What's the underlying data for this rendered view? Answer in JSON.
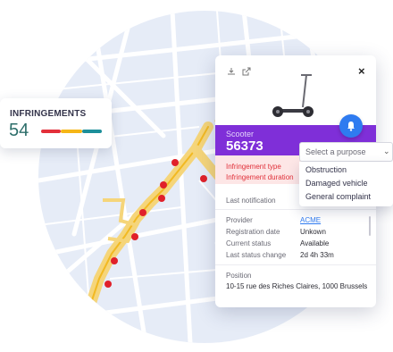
{
  "infringements": {
    "title": "INFRINGEMENTS",
    "count": "54",
    "bar_colors": [
      "#e3303a",
      "#f5b617",
      "#1d8f9a"
    ]
  },
  "popup": {
    "icons": [
      "download-icon",
      "external-link-icon"
    ],
    "close_label": "×",
    "vehicle_image": "scooter",
    "vehicle_type": "Scooter",
    "vehicle_id": "56373",
    "header_color": "#7f2fd8",
    "infringement_type_label": "Infringement type",
    "infringement_duration_label": "Infringement duration",
    "last_notification_label": "Last notification",
    "details": [
      {
        "label": "Provider",
        "value": "ACME",
        "link": true
      },
      {
        "label": "Registration date",
        "value": "Unkown",
        "link": false
      },
      {
        "label": "Current status",
        "value": "Available",
        "link": false
      },
      {
        "label": "Last status change",
        "value": "2d 4h 33m",
        "link": false
      }
    ],
    "position_label": "Position",
    "position_value": "10-15 rue des Riches Claires, 1000 Brussels"
  },
  "purpose_select": {
    "placeholder": "Select a purpose",
    "options": [
      "Obstruction",
      "Damaged vehicle",
      "General complaint"
    ]
  },
  "map": {
    "marker_color": "#e0202a",
    "route_color": "#f5c542"
  }
}
